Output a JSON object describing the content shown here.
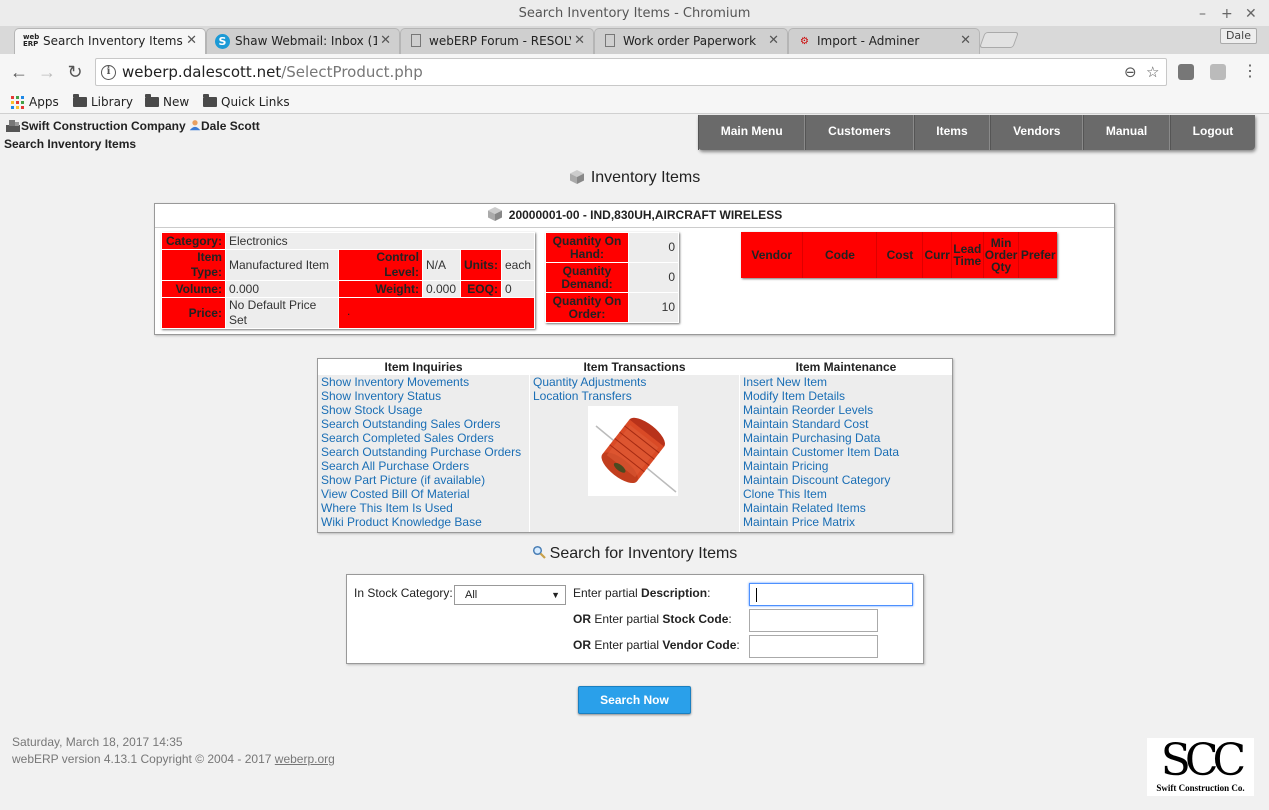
{
  "window": {
    "title": "Search Inventory Items - Chromium"
  },
  "tabs": [
    {
      "label": "Search Inventory Items",
      "icon": "weberp-icon"
    },
    {
      "label": "Shaw Webmail: Inbox (1",
      "icon": "shaw-icon"
    },
    {
      "label": "webERP Forum - RESOLV",
      "icon": "page-icon"
    },
    {
      "label": "Work order Paperwork",
      "icon": "page-icon"
    },
    {
      "label": "Import - Adminer",
      "icon": "adminer-icon"
    }
  ],
  "profile_name": "Dale",
  "address": {
    "host": "weberp.dalescott.net",
    "path": "/SelectProduct.php"
  },
  "bookmarks": [
    {
      "label": "Apps"
    },
    {
      "label": "Library"
    },
    {
      "label": "New"
    },
    {
      "label": "Quick Links"
    }
  ],
  "header": {
    "company": "Swift Construction Company",
    "user": "Dale Scott",
    "breadcrumb": "Search Inventory Items"
  },
  "menu": [
    "Main Menu",
    "Customers",
    "Items",
    "Vendors",
    "Manual",
    "Logout"
  ],
  "inventory": {
    "title": "Inventory Items",
    "item_heading": "20000001-00 - IND,830UH,AIRCRAFT WIRELESS",
    "category_label": "Category:",
    "category": "Electronics",
    "item_type_label": "Item Type:",
    "item_type": "Manufactured Item",
    "control_level_label": "Control Level:",
    "control_level": "N/A",
    "units_label": "Units:",
    "units": "each",
    "volume_label": "Volume:",
    "volume": "0.000",
    "weight_label": "Weight:",
    "weight": "0.000",
    "eoq_label": "EOQ:",
    "eoq": "0",
    "price_label": "Price:",
    "price": "No Default Price Set",
    "qoh_label": "Quantity On Hand:",
    "qoh": "0",
    "qd_label": "Quantity Demand:",
    "qd": "0",
    "qoo_label": "Quantity On Order:",
    "qoo": "10",
    "dot": "."
  },
  "vendor_headers": [
    "Vendor",
    "Code",
    "Cost",
    "Curr",
    "Lead Time",
    "Min Order Qty",
    "Prefer"
  ],
  "inquiries": {
    "heading": "Item Inquiries",
    "links": [
      "Show Inventory Movements",
      "Show Inventory Status",
      "Show Stock Usage",
      "Search Outstanding Sales Orders",
      "Search Completed Sales Orders",
      "Search Outstanding Purchase Orders",
      "Search All Purchase Orders",
      "Show Part Picture (if available)",
      "View Costed Bill Of Material",
      "Where This Item Is Used",
      "Wiki Product Knowledge Base"
    ]
  },
  "transactions": {
    "heading": "Item Transactions",
    "links": [
      "Quantity Adjustments",
      "Location Transfers"
    ]
  },
  "maintenance": {
    "heading": "Item Maintenance",
    "links": [
      "Insert New Item",
      "Modify Item Details",
      "Maintain Reorder Levels",
      "Maintain Standard Cost",
      "Maintain Purchasing Data",
      "Maintain Customer Item Data",
      "Maintain Pricing",
      "Maintain Discount Category",
      "Clone This Item",
      "Maintain Related Items",
      "Maintain Price Matrix"
    ]
  },
  "search": {
    "title": "Search for Inventory Items",
    "category_label": "In Stock Category:",
    "category_value": "All",
    "desc_pre": "Enter partial ",
    "desc_bold": "Description",
    "desc_post": ":",
    "code_or": "OR",
    "code_pre": " Enter partial ",
    "code_bold": "Stock Code",
    "code_post": ":",
    "vendor_or": "OR",
    "vendor_pre": " Enter partial ",
    "vendor_bold": "Vendor Code",
    "vendor_post": ":",
    "button": "Search Now"
  },
  "footer": {
    "date": "Saturday, March 18, 2017 14:35",
    "version": "webERP version 4.13.1 Copyright © 2004 - 2017 ",
    "link": "weberp.org"
  },
  "logo": {
    "big": "SCC",
    "small": "Swift Construction Co."
  },
  "colors": {
    "accent_red": "#ff0000",
    "link_blue": "#1a6eb5",
    "button_blue": "#2aa0ea",
    "menu_gray": "#6a6a6a"
  }
}
